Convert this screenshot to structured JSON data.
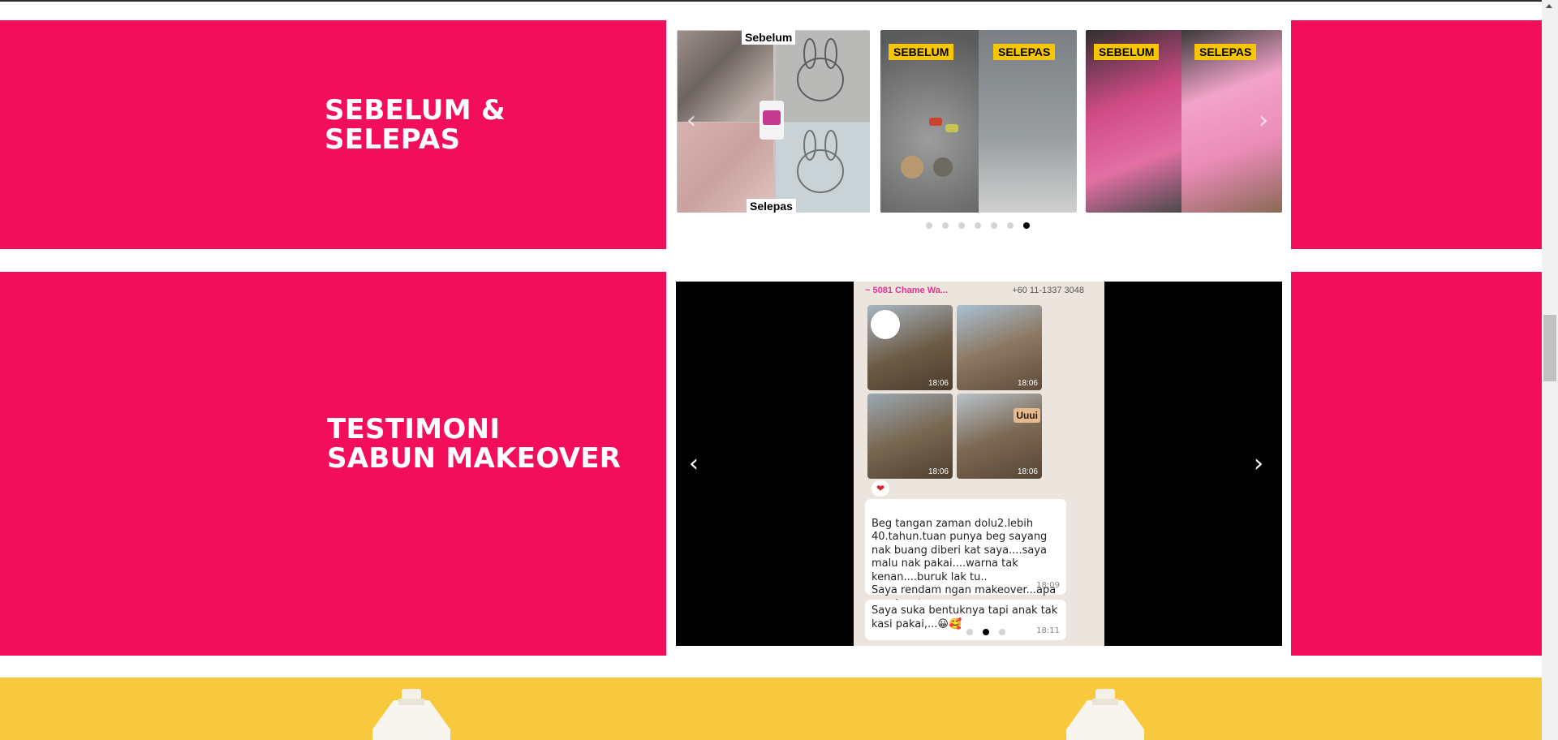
{
  "sections": {
    "before_after": {
      "heading_lines": [
        "SEBELUM &",
        "SELEPAS"
      ],
      "slides": [
        {
          "caption_top": "Sebelum",
          "caption_bottom": "Selepas"
        },
        {
          "badge_left": "SEBELUM",
          "badge_right": "SELEPAS"
        },
        {
          "badge_left": "SEBELUM",
          "badge_right": "SELEPAS"
        }
      ],
      "dots_total": 7,
      "active_dot": 7
    },
    "testimonial": {
      "heading_lines": [
        "TESTIMONI",
        "SABUN MAKEOVER"
      ],
      "chat": {
        "sender": "~ 5081 Chame Wa...",
        "phone": "+60 11-1337 3048",
        "photo_times": [
          "18:06",
          "18:06",
          "18:06",
          "18:06"
        ],
        "sticker_text": "Uuui",
        "message1": "Beg tangan zaman dolu2.lebih 40.tahun.tuan punya beg sayang nak buang diberi kat saya....saya malu nak pakai....warna tak kenan....buruk lak tu..\nSaya rendam ngan makeover...apa pendapat   semua....",
        "message1_time": "18:09",
        "message2": "Saya suka bentuknya tapi anak tak kasi pakai,...😀🥰",
        "message2_time": "18:11"
      },
      "dots_total": 3,
      "active_dot": 2
    }
  },
  "colors": {
    "brand_pink": "#f20e5b",
    "badge_yellow": "#f7c600",
    "banner_yellow": "#f9c93d"
  },
  "icons": {
    "prev": "chevron-left-icon",
    "next": "chevron-right-icon"
  }
}
